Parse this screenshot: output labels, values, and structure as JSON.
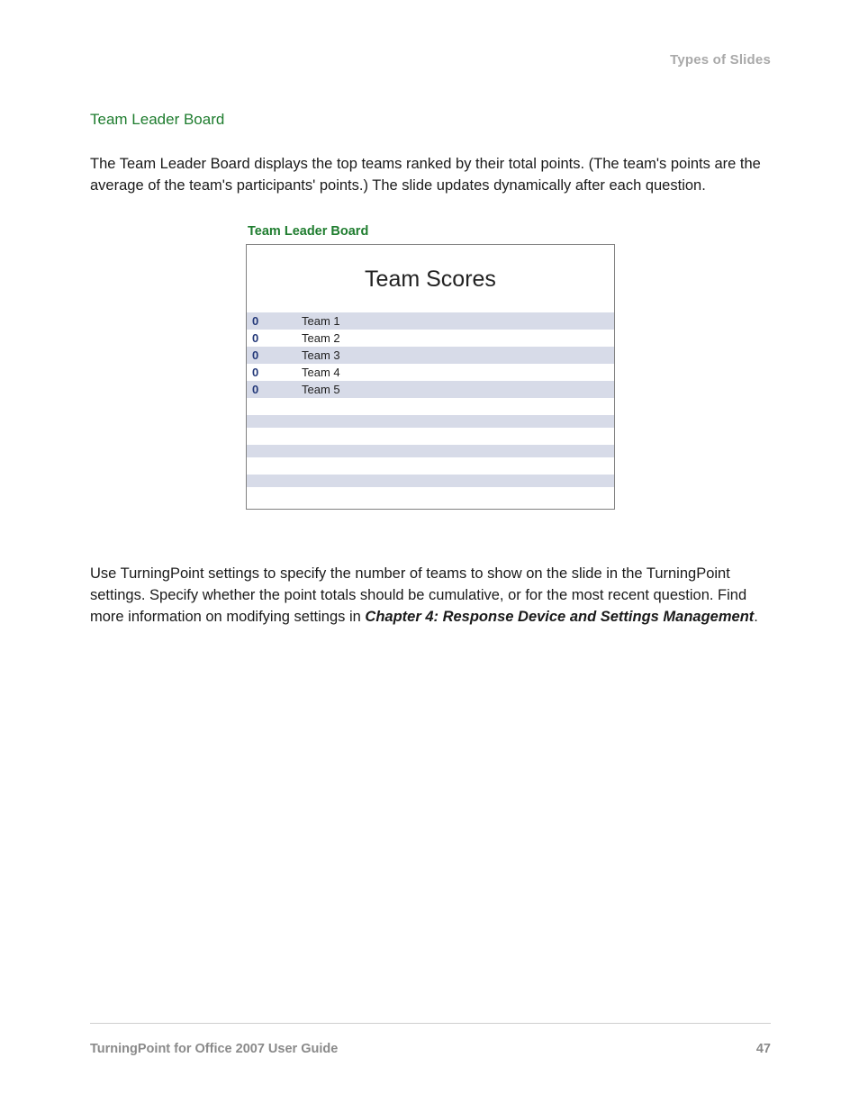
{
  "header": {
    "running_head": "Types of Slides"
  },
  "section": {
    "heading": "Team Leader Board",
    "para1": "The Team Leader Board displays the top teams ranked by their total points. (The team's points are the average of the team's participants' points.) The slide updates dynamically after each question.",
    "para2_pre": "Use TurningPoint settings to specify the number of teams to show on the slide in the TurningPoint settings. Specify whether the point totals should be cumulative, or for the most recent question. Find more information on modifying settings in ",
    "para2_emph": "Chapter 4: Response Device and Settings Management",
    "para2_post": "."
  },
  "figure": {
    "caption": "Team Leader Board",
    "slide_title": "Team Scores",
    "rows": [
      {
        "score": "0",
        "name": "Team 1"
      },
      {
        "score": "0",
        "name": "Team 2"
      },
      {
        "score": "0",
        "name": "Team 3"
      },
      {
        "score": "0",
        "name": "Team 4"
      },
      {
        "score": "0",
        "name": "Team 5"
      }
    ]
  },
  "footer": {
    "doc_title": "TurningPoint for Office 2007 User Guide",
    "page_number": "47"
  }
}
